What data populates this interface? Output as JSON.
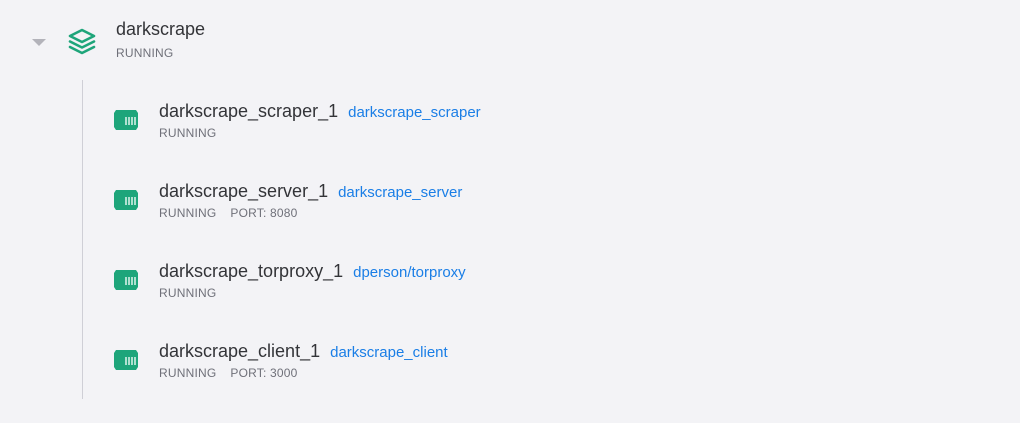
{
  "colors": {
    "background": "#f3f3f6",
    "accent_green": "#1ea57a",
    "link_blue": "#1a7ee6",
    "text_primary": "#333438",
    "text_secondary": "#6f7079",
    "caret_gray": "#b3b3ba"
  },
  "app": {
    "name": "darkscrape",
    "status": "RUNNING",
    "icon": "stack-icon",
    "expand_icon": "caret-down-icon"
  },
  "containers": [
    {
      "name": "darkscrape_scraper_1",
      "image": "darkscrape_scraper",
      "status": "RUNNING",
      "port": "",
      "icon": "container-icon"
    },
    {
      "name": "darkscrape_server_1",
      "image": "darkscrape_server",
      "status": "RUNNING",
      "port": "PORT: 8080",
      "icon": "container-icon"
    },
    {
      "name": "darkscrape_torproxy_1",
      "image": "dperson/torproxy",
      "status": "RUNNING",
      "port": "",
      "icon": "container-icon"
    },
    {
      "name": "darkscrape_client_1",
      "image": "darkscrape_client",
      "status": "RUNNING",
      "port": "PORT: 3000",
      "icon": "container-icon"
    }
  ]
}
